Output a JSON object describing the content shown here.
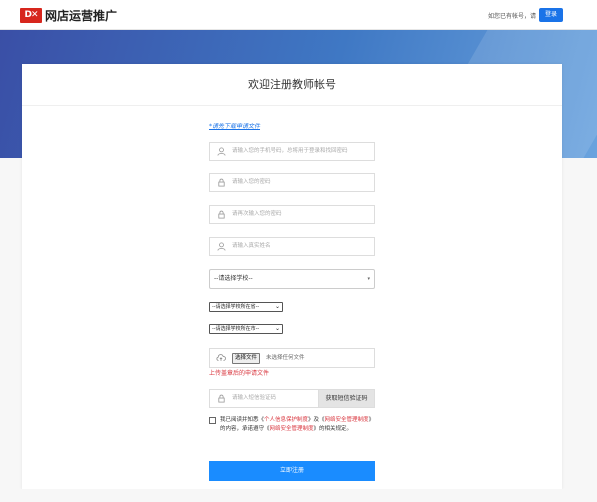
{
  "header": {
    "logo_mark": "D✕",
    "logo_text": "网店运营推广",
    "login_hint": "如您已有帐号，请",
    "login_label": "登录"
  },
  "form": {
    "title": "欢迎注册教师帐号",
    "download_link": "*请先下载申请文件",
    "phone_placeholder": "请输入您的手机号码，总将用于登录和找回密码",
    "password_placeholder": "请输入您的密码",
    "password_confirm_placeholder": "请再次输入您的密码",
    "name_placeholder": "请输入真实姓名",
    "school_select": "--请选择学校--",
    "province_select": "--请选择学校所在省--",
    "city_select": "--请选择学校所在市--",
    "file_button": "选择文件",
    "file_status": "未选择任何文件",
    "upload_tip": "上传盖章后的申请文件",
    "sms_placeholder": "请输入短信验证码",
    "sms_button": "获取短信验证码",
    "agree_prefix": "我已阅读并知悉《",
    "agree_link1": "个人信息保护制度",
    "agree_mid1": "》及《",
    "agree_link2": "网络安全管理制度",
    "agree_mid2": "》的内容，承诺遵守《",
    "agree_link3": "网络安全管理制度",
    "agree_suffix": "》的相关规定。",
    "submit_label": "立即注册"
  },
  "icons": {
    "user": "user-icon",
    "lock": "lock-icon",
    "cloud": "cloud-upload-icon",
    "dropdown": "chevron-down-icon"
  },
  "colors": {
    "brand_red": "#d7261d",
    "primary_blue": "#1a8cff",
    "banner_start": "#3a4fa6",
    "banner_end": "#6aa3de",
    "error_red": "#d9363e"
  }
}
